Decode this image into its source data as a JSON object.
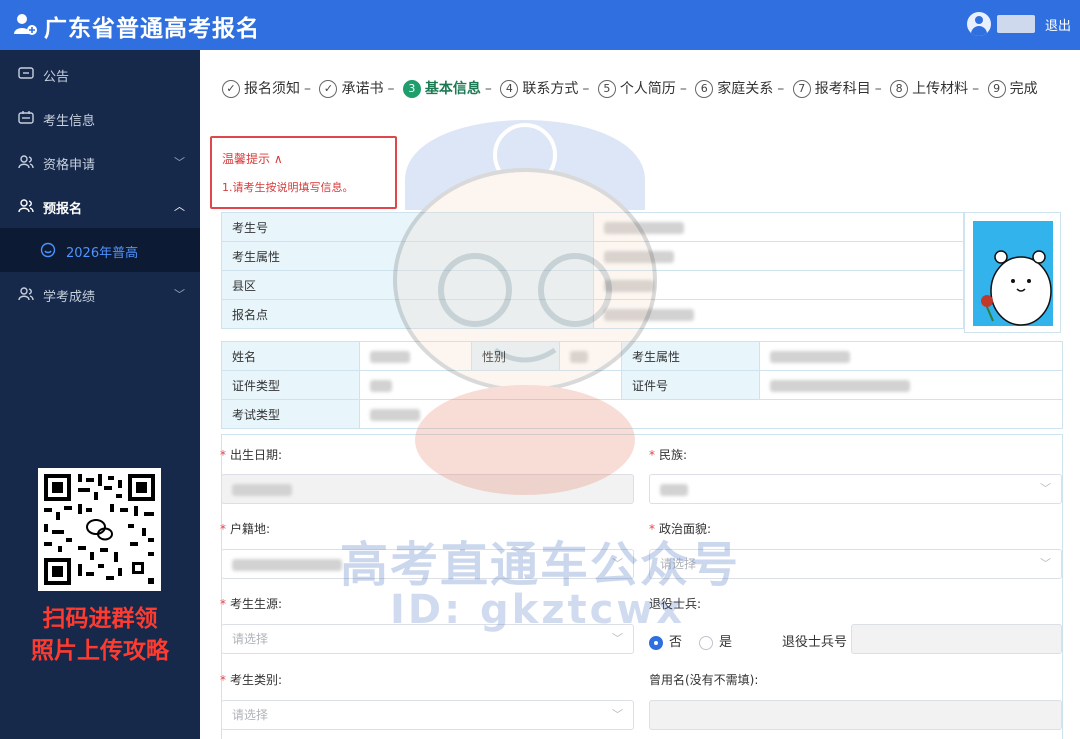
{
  "header": {
    "title": "广东省普通高考报名",
    "logout_label": "退出"
  },
  "sidebar": {
    "items": [
      {
        "label": "公告",
        "icon": "monitor-icon"
      },
      {
        "label": "考生信息",
        "icon": "id-card-icon"
      },
      {
        "label": "资格申请",
        "icon": "users-icon",
        "chevron": "﹀"
      },
      {
        "label": "预报名",
        "icon": "users-icon",
        "chevron": "︿"
      },
      {
        "label": "2026年普高",
        "icon": "smile-icon"
      },
      {
        "label": "学考成绩",
        "icon": "users-icon",
        "chevron": "﹀"
      }
    ],
    "promo_lines": [
      "扫码进群领",
      "照片上传攻略"
    ]
  },
  "steps": [
    {
      "num": "✓",
      "label": "报名须知",
      "state": "done"
    },
    {
      "num": "✓",
      "label": "承诺书",
      "state": "done"
    },
    {
      "num": "3",
      "label": "基本信息",
      "state": "active"
    },
    {
      "num": "4",
      "label": "联系方式",
      "state": "todo"
    },
    {
      "num": "5",
      "label": "个人简历",
      "state": "todo"
    },
    {
      "num": "6",
      "label": "家庭关系",
      "state": "todo"
    },
    {
      "num": "7",
      "label": "报考科目",
      "state": "todo"
    },
    {
      "num": "8",
      "label": "上传材料",
      "state": "todo"
    },
    {
      "num": "9",
      "label": "完成",
      "state": "todo"
    }
  ],
  "tip": {
    "title": "温馨提示 ∧",
    "body": "1.请考生按说明填写信息。"
  },
  "info_table_1": {
    "labels": [
      "考生号",
      "考生属性",
      "县区",
      "报名点"
    ]
  },
  "info_table_2": {
    "name_label": "姓名",
    "gender_label": "性别",
    "attr_label": "考生属性",
    "idtype_label": "证件类型",
    "idno_label": "证件号",
    "examtype_label": "考试类型"
  },
  "form": {
    "birth_label": "出生日期:",
    "ethnic_label": "民族:",
    "household_label": "户籍地:",
    "political_label": "政治面貌:",
    "political_placeholder": "请选择",
    "source_label": "考生生源:",
    "source_placeholder": "请选择",
    "veteran_label": "退役士兵:",
    "veteran_no": "否",
    "veteran_yes": "是",
    "veteran_number_label": "退役士兵号",
    "category_label": "考生类别:",
    "category_placeholder": "请选择",
    "former_name_label": "曾用名(没有不需填):"
  },
  "watermark": {
    "line1": "高考直通车公众号",
    "line2": "ID: gkztcwx"
  }
}
